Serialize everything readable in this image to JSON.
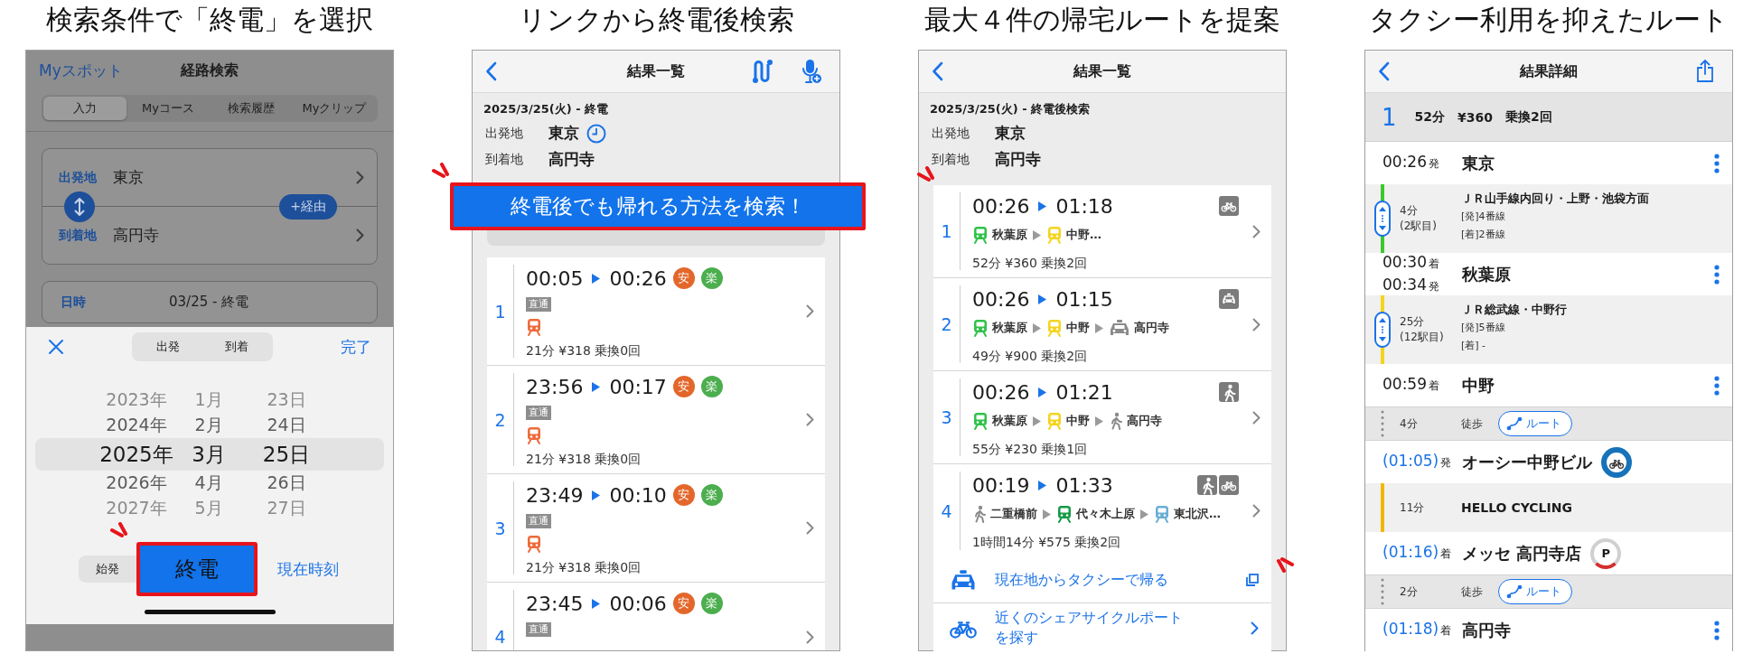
{
  "panels": [
    {
      "kind": "search",
      "caption": "検索条件で「終電」を選択",
      "nav": {
        "left": "Myスポット",
        "title": "経路検索"
      },
      "tabs": [
        {
          "label": "入力",
          "selected": true
        },
        {
          "label": "Myコース",
          "selected": false
        },
        {
          "label": "検索履歴",
          "selected": false
        },
        {
          "label": "Myクリップ",
          "selected": false
        }
      ],
      "from": {
        "label": "出発地",
        "value": "東京"
      },
      "to": {
        "label": "到着地",
        "value": "高円寺"
      },
      "via_button": "+経由",
      "datetime": {
        "label": "日時",
        "value": "03/25 - 終電"
      },
      "modes": [
        {
          "label": "出発",
          "selected": false
        },
        {
          "label": "到着",
          "selected": false
        }
      ],
      "done": "完了",
      "picker_rows": [
        {
          "year": "2023年",
          "month": "1月",
          "day": "23日",
          "selected": false
        },
        {
          "year": "2024年",
          "month": "2月",
          "day": "24日",
          "selected": false
        },
        {
          "year": "2025年",
          "month": "3月",
          "day": "25日",
          "selected": true
        },
        {
          "year": "2026年",
          "month": "4月",
          "day": "26日",
          "selected": false
        },
        {
          "year": "2027年",
          "month": "5月",
          "day": "27日",
          "selected": false
        }
      ],
      "quick": [
        {
          "label": "始発",
          "selected": false
        },
        {
          "label": "終電",
          "selected": true
        }
      ],
      "now_link": "現在時刻"
    },
    {
      "kind": "results",
      "caption": "リンクから終電後検索",
      "title": "結果一覧",
      "date": "2025/3/25(火) - 終電",
      "from": {
        "label": "出発地",
        "value": "東京"
      },
      "to": {
        "label": "到着地",
        "value": "高円寺"
      },
      "banner": "終電後でも帰れる方法を検索！",
      "routes": [
        {
          "number": "1",
          "depart": "00:05",
          "arrive": "00:26",
          "badges": [
            {
              "text": "安",
              "color": "#e3672b"
            },
            {
              "text": "楽",
              "color": "#4cae4f"
            }
          ],
          "tag": "直通",
          "legs": [
            {
              "kind": "train",
              "color": "#ee6a3a"
            }
          ],
          "summary": "21分 ¥318 乗換0回"
        },
        {
          "number": "2",
          "depart": "23:56",
          "arrive": "00:17",
          "badges": [
            {
              "text": "安",
              "color": "#e3672b"
            },
            {
              "text": "楽",
              "color": "#4cae4f"
            }
          ],
          "tag": "直通",
          "legs": [
            {
              "kind": "train",
              "color": "#ee6a3a"
            }
          ],
          "summary": "21分 ¥318 乗換0回"
        },
        {
          "number": "3",
          "depart": "23:49",
          "arrive": "00:10",
          "badges": [
            {
              "text": "安",
              "color": "#e3672b"
            },
            {
              "text": "楽",
              "color": "#4cae4f"
            }
          ],
          "tag": "直通",
          "legs": [
            {
              "kind": "train",
              "color": "#ee6a3a"
            }
          ],
          "summary": "21分 ¥318 乗換0回"
        },
        {
          "number": "4",
          "depart": "23:45",
          "arrive": "00:06",
          "badges": [
            {
              "text": "安",
              "color": "#e3672b"
            },
            {
              "text": "楽",
              "color": "#4cae4f"
            }
          ],
          "tag": "直通"
        }
      ]
    },
    {
      "kind": "after_last_train",
      "caption": "最大４件の帰宅ルートを提案",
      "title": "結果一覧",
      "date": "2025/3/25(火) - 終電後検索",
      "from": {
        "label": "出発地",
        "value": "東京"
      },
      "to": {
        "label": "到着地",
        "value": "高円寺"
      },
      "routes": [
        {
          "number": "1",
          "depart": "00:26",
          "arrive": "01:18",
          "modes": [
            {
              "kind": "bicycle"
            }
          ],
          "legs": [
            {
              "kind": "train",
              "color": "#2fc24a",
              "station": "秋葉原"
            },
            {
              "kind": "train",
              "color": "#f4d41c",
              "station": "中野…"
            }
          ],
          "summary": "52分 ¥360 乗換2回"
        },
        {
          "number": "2",
          "depart": "00:26",
          "arrive": "01:15",
          "modes": [
            {
              "kind": "car"
            }
          ],
          "legs": [
            {
              "kind": "train",
              "color": "#2fc24a",
              "station": "秋葉原"
            },
            {
              "kind": "train",
              "color": "#f4d41c",
              "station": "中野"
            },
            {
              "kind": "taxi",
              "station": "高円寺"
            }
          ],
          "summary": "49分 ¥900 乗換2回"
        },
        {
          "number": "3",
          "depart": "00:26",
          "arrive": "01:21",
          "modes": [
            {
              "kind": "walk"
            }
          ],
          "legs": [
            {
              "kind": "train",
              "color": "#2fc24a",
              "station": "秋葉原"
            },
            {
              "kind": "train",
              "color": "#f4d41c",
              "station": "中野"
            },
            {
              "kind": "walk",
              "station": "高円寺"
            }
          ],
          "summary": "55分 ¥230 乗換1回"
        },
        {
          "number": "4",
          "depart": "00:19",
          "arrive": "01:33",
          "modes": [
            {
              "kind": "walk"
            },
            {
              "kind": "bicycle"
            }
          ],
          "legs": [
            {
              "kind": "walk",
              "station": "二重橋前"
            },
            {
              "kind": "train",
              "color": "#159a48",
              "station": "代々木上原"
            },
            {
              "kind": "train",
              "color": "#6aaed6",
              "station": "東北沢…"
            }
          ],
          "summary": "1時間14分 ¥575 乗換2回"
        }
      ],
      "links": [
        {
          "kind": "taxi",
          "text": "現在地からタクシーで帰る"
        },
        {
          "kind": "bicycle",
          "text": "近くのシェアサイクルポートを探す"
        }
      ]
    },
    {
      "kind": "detail",
      "caption": "タクシー利用を抑えたルート",
      "title": "結果詳細",
      "summary": {
        "number": "1",
        "items": [
          "52分",
          "¥360",
          "乗換2回"
        ]
      },
      "steps": [
        {
          "kind": "station",
          "times": [
            {
              "time": "00:26",
              "mark": "発"
            }
          ],
          "name": "東京",
          "estimated": false,
          "menu": true
        },
        {
          "kind": "ride",
          "color": "#3cc92e",
          "duration": "4分",
          "stops": "(2駅目)",
          "line": "ＪＲ山手線内回り・上野・池袋方面",
          "platforms": [
            "[発]4番線",
            "[着]2番線"
          ]
        },
        {
          "kind": "station",
          "times": [
            {
              "time": "00:30",
              "mark": "着"
            },
            {
              "time": "00:34",
              "mark": "発"
            }
          ],
          "name": "秋葉原",
          "estimated": false,
          "menu": true
        },
        {
          "kind": "ride",
          "color": "#f4d41c",
          "duration": "25分",
          "stops": "(12駅目)",
          "line": "ＪＲ総武線・中野行",
          "platforms": [
            "[発]5番線",
            "[着] -"
          ]
        },
        {
          "kind": "station",
          "times": [
            {
              "time": "00:59",
              "mark": "着"
            }
          ],
          "name": "中野",
          "estimated": false,
          "menu": true
        },
        {
          "kind": "walk",
          "duration": "4分",
          "mode": "徒歩",
          "button": "ルート"
        },
        {
          "kind": "station",
          "times": [
            {
              "time": "(01:05)",
              "mark": "発"
            }
          ],
          "name": "オーシー中野ビル",
          "estimated": true,
          "menu": false,
          "badge": {
            "kind": "bicycle"
          }
        },
        {
          "kind": "cycle",
          "color": "#f2b705",
          "duration": "11分",
          "line": "HELLO CYCLING"
        },
        {
          "kind": "station",
          "times": [
            {
              "time": "(01:16)",
              "mark": "着"
            }
          ],
          "name": "メッセ 高円寺店",
          "estimated": true,
          "menu": false,
          "badge": {
            "kind": "parking",
            "text": "P"
          }
        },
        {
          "kind": "walk",
          "duration": "2分",
          "mode": "徒歩",
          "button": "ルート"
        },
        {
          "kind": "station",
          "times": [
            {
              "time": "(01:18)",
              "mark": "着"
            }
          ],
          "name": "高円寺",
          "estimated": true,
          "menu": true
        }
      ]
    }
  ]
}
